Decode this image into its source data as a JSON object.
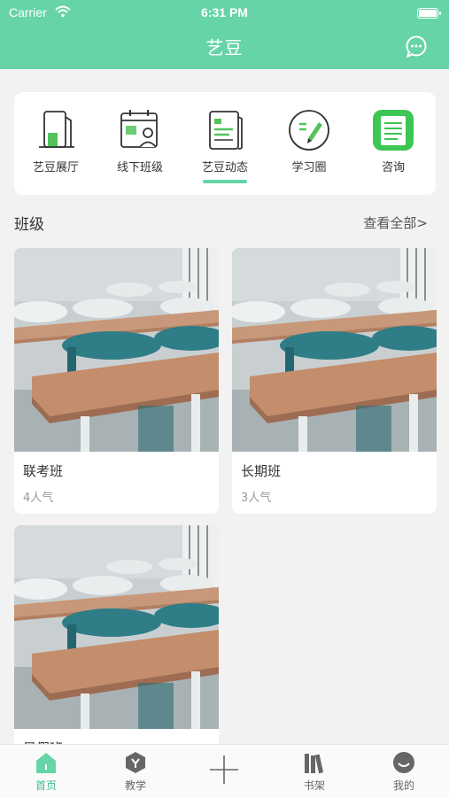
{
  "status_bar": {
    "carrier": "Carrier",
    "time": "6:31 PM"
  },
  "header": {
    "title": "艺豆"
  },
  "menu": [
    {
      "label": "艺豆展厅",
      "icon": "gallery-icon"
    },
    {
      "label": "线下班级",
      "icon": "offline-class-icon"
    },
    {
      "label": "艺豆动态",
      "icon": "news-icon"
    },
    {
      "label": "学习圈",
      "icon": "study-circle-icon"
    },
    {
      "label": "咨询",
      "icon": "consult-icon"
    }
  ],
  "section": {
    "title": "班级",
    "see_all": "查看全部>"
  },
  "courses": [
    {
      "name": "联考班",
      "popularity": "4人气"
    },
    {
      "name": "长期班",
      "popularity": "3人气"
    },
    {
      "name": "暑假班",
      "popularity": ""
    }
  ],
  "tabbar": [
    {
      "label": "首页",
      "icon": "home-icon",
      "active": true
    },
    {
      "label": "教学",
      "icon": "teaching-icon"
    },
    {
      "label": "",
      "icon": "add-icon"
    },
    {
      "label": "书架",
      "icon": "bookshelf-icon"
    },
    {
      "label": "我的",
      "icon": "profile-icon"
    }
  ],
  "colors": {
    "accent": "#66d4a7",
    "accent_text": "#3fbf8c",
    "background": "#f2f2f2"
  }
}
